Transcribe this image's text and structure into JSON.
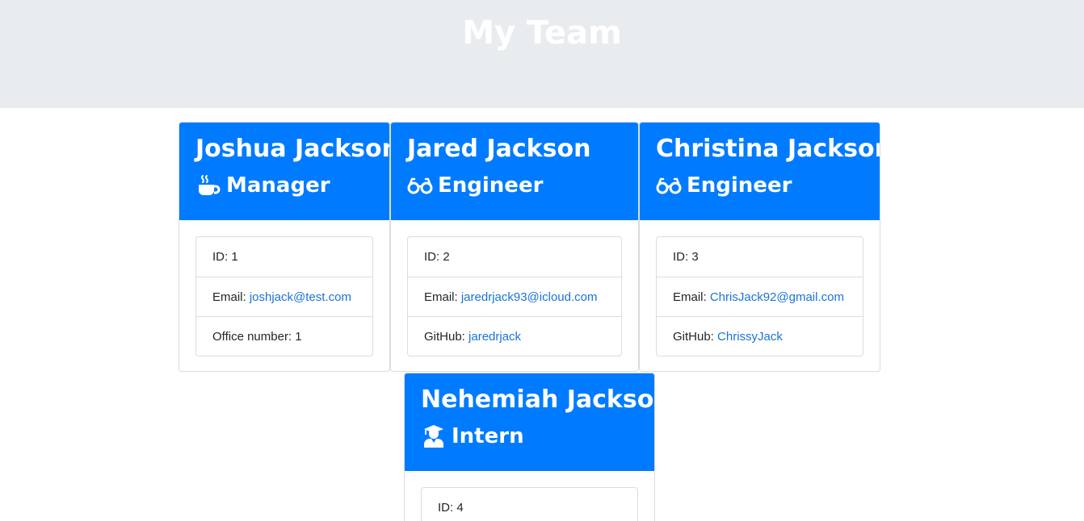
{
  "header": {
    "title": "My Team"
  },
  "colors": {
    "accent": "#007bff",
    "link": "#1a73d9",
    "jumbotron": "#e9ecef"
  },
  "employees": [
    {
      "name": "Joshua Jackson",
      "role": "Manager",
      "icon": "mug-hot-icon",
      "rows": [
        {
          "label": "ID: ",
          "value": "1"
        },
        {
          "label": "Email: ",
          "value": "joshjack@test.com"
        },
        {
          "label": "Office number: ",
          "value": "1"
        }
      ]
    },
    {
      "name": "Jared Jackson",
      "role": "Engineer",
      "icon": "glasses-icon",
      "rows": [
        {
          "label": "ID: ",
          "value": "2"
        },
        {
          "label": "Email: ",
          "value": "jaredrjack93@icloud.com"
        },
        {
          "label": "GitHub: ",
          "value": "jaredrjack"
        }
      ]
    },
    {
      "name": "Christina Jackson",
      "role": "Engineer",
      "icon": "glasses-icon",
      "rows": [
        {
          "label": "ID: ",
          "value": "3"
        },
        {
          "label": "Email: ",
          "value": "ChrisJack92@gmail.com"
        },
        {
          "label": "GitHub: ",
          "value": "ChrissyJack"
        }
      ]
    },
    {
      "name": "Nehemiah Jackson",
      "role": "Intern",
      "icon": "user-graduate-icon",
      "rows": [
        {
          "label": "ID: ",
          "value": "4"
        }
      ]
    }
  ]
}
